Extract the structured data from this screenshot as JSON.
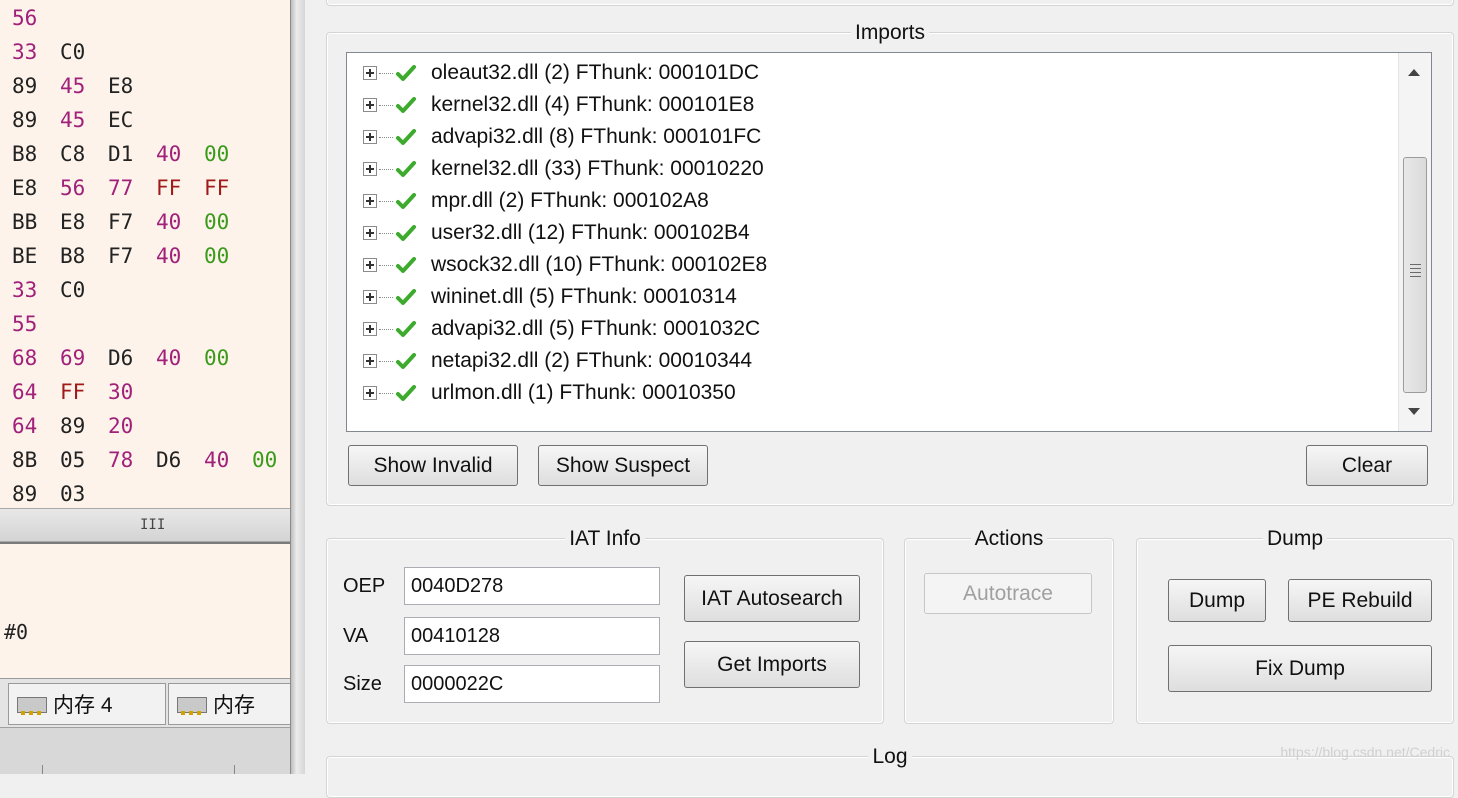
{
  "left_pane": {
    "hex_rows": [
      [
        {
          "t": "56",
          "c": "#a0207a"
        }
      ],
      [
        {
          "t": "33",
          "c": "#a0207a"
        },
        {
          "t": "C0",
          "c": "#222222"
        }
      ],
      [
        {
          "t": "89",
          "c": "#222222"
        },
        {
          "t": "45",
          "c": "#a0207a"
        },
        {
          "t": "E8",
          "c": "#222222"
        }
      ],
      [
        {
          "t": "89",
          "c": "#222222"
        },
        {
          "t": "45",
          "c": "#a0207a"
        },
        {
          "t": "EC",
          "c": "#222222"
        }
      ],
      [
        {
          "t": "B8",
          "c": "#222222"
        },
        {
          "t": "C8",
          "c": "#222222"
        },
        {
          "t": "D1",
          "c": "#222222"
        },
        {
          "t": "40",
          "c": "#a0207a"
        },
        {
          "t": "00",
          "c": "#3a9a1a"
        }
      ],
      [
        {
          "t": "E8",
          "c": "#222222"
        },
        {
          "t": "56",
          "c": "#a0207a"
        },
        {
          "t": "77",
          "c": "#a0207a"
        },
        {
          "t": "FF",
          "c": "#a01a1a"
        },
        {
          "t": "FF",
          "c": "#a01a1a"
        }
      ],
      [
        {
          "t": "BB",
          "c": "#222222"
        },
        {
          "t": "E8",
          "c": "#222222"
        },
        {
          "t": "F7",
          "c": "#222222"
        },
        {
          "t": "40",
          "c": "#a0207a"
        },
        {
          "t": "00",
          "c": "#3a9a1a"
        }
      ],
      [
        {
          "t": "BE",
          "c": "#222222"
        },
        {
          "t": "B8",
          "c": "#222222"
        },
        {
          "t": "F7",
          "c": "#222222"
        },
        {
          "t": "40",
          "c": "#a0207a"
        },
        {
          "t": "00",
          "c": "#3a9a1a"
        }
      ],
      [
        {
          "t": "33",
          "c": "#a0207a"
        },
        {
          "t": "C0",
          "c": "#222222"
        }
      ],
      [
        {
          "t": "55",
          "c": "#a0207a"
        }
      ],
      [
        {
          "t": "68",
          "c": "#a0207a"
        },
        {
          "t": "69",
          "c": "#a0207a"
        },
        {
          "t": "D6",
          "c": "#222222"
        },
        {
          "t": "40",
          "c": "#a0207a"
        },
        {
          "t": "00",
          "c": "#3a9a1a"
        }
      ],
      [
        {
          "t": "64",
          "c": "#a0207a"
        },
        {
          "t": "FF",
          "c": "#a01a1a"
        },
        {
          "t": "30",
          "c": "#a0207a"
        }
      ],
      [
        {
          "t": "64",
          "c": "#a0207a"
        },
        {
          "t": "89",
          "c": "#222222"
        },
        {
          "t": "20",
          "c": "#a0207a"
        }
      ],
      [
        {
          "t": "8B",
          "c": "#222222"
        },
        {
          "t": "05",
          "c": "#222222"
        },
        {
          "t": "78",
          "c": "#a0207a"
        },
        {
          "t": "D6",
          "c": "#222222"
        },
        {
          "t": "40",
          "c": "#a0207a"
        },
        {
          "t": "00",
          "c": "#3a9a1a"
        }
      ],
      [
        {
          "t": "89",
          "c": "#222222"
        },
        {
          "t": "03",
          "c": "#222222"
        }
      ]
    ],
    "splitter_grip": "III",
    "lower_text": "#0",
    "mem_tabs": [
      "内存 4",
      "内存"
    ]
  },
  "imports": {
    "title": "Imports",
    "check_color": "#3caa2c",
    "items": [
      "oleaut32.dll (2) FThunk: 000101DC",
      "kernel32.dll (4) FThunk: 000101E8",
      "advapi32.dll (8) FThunk: 000101FC",
      "kernel32.dll (33) FThunk: 00010220",
      "mpr.dll (2) FThunk: 000102A8",
      "user32.dll (12) FThunk: 000102B4",
      "wsock32.dll (10) FThunk: 000102E8",
      "wininet.dll (5) FThunk: 00010314",
      "advapi32.dll (5) FThunk: 0001032C",
      "netapi32.dll (2) FThunk: 00010344",
      "urlmon.dll (1) FThunk: 00010350"
    ],
    "show_invalid": "Show Invalid",
    "show_suspect": "Show Suspect",
    "clear": "Clear"
  },
  "iat_info": {
    "title": "IAT Info",
    "oep_label": "OEP",
    "oep_value": "0040D278",
    "va_label": "VA",
    "va_value": "00410128",
    "size_label": "Size",
    "size_value": "0000022C",
    "iat_autosearch": "IAT Autosearch",
    "get_imports": "Get Imports"
  },
  "actions": {
    "title": "Actions",
    "autotrace": "Autotrace"
  },
  "dump": {
    "title": "Dump",
    "dump": "Dump",
    "pe_rebuild": "PE Rebuild",
    "fix_dump": "Fix Dump"
  },
  "log": {
    "title": "Log"
  },
  "watermark": "https://blog.csdn.net/Cedric"
}
